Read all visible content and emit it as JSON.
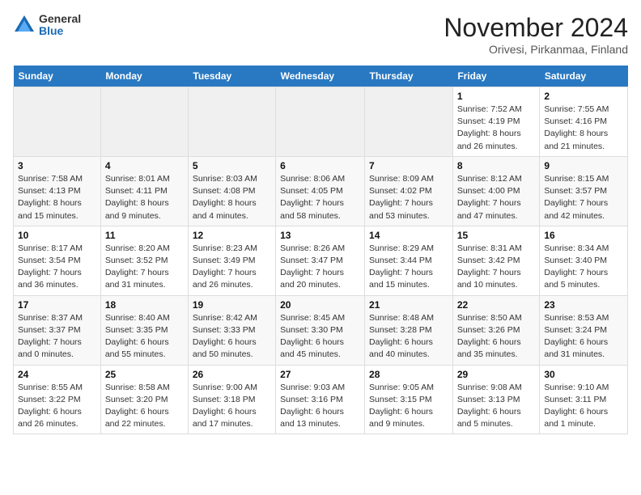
{
  "logo": {
    "general": "General",
    "blue": "Blue"
  },
  "title": "November 2024",
  "subtitle": "Orivesi, Pirkanmaa, Finland",
  "days_of_week": [
    "Sunday",
    "Monday",
    "Tuesday",
    "Wednesday",
    "Thursday",
    "Friday",
    "Saturday"
  ],
  "weeks": [
    [
      {
        "day": "",
        "info": ""
      },
      {
        "day": "",
        "info": ""
      },
      {
        "day": "",
        "info": ""
      },
      {
        "day": "",
        "info": ""
      },
      {
        "day": "",
        "info": ""
      },
      {
        "day": "1",
        "info": "Sunrise: 7:52 AM\nSunset: 4:19 PM\nDaylight: 8 hours and 26 minutes."
      },
      {
        "day": "2",
        "info": "Sunrise: 7:55 AM\nSunset: 4:16 PM\nDaylight: 8 hours and 21 minutes."
      }
    ],
    [
      {
        "day": "3",
        "info": "Sunrise: 7:58 AM\nSunset: 4:13 PM\nDaylight: 8 hours and 15 minutes."
      },
      {
        "day": "4",
        "info": "Sunrise: 8:01 AM\nSunset: 4:11 PM\nDaylight: 8 hours and 9 minutes."
      },
      {
        "day": "5",
        "info": "Sunrise: 8:03 AM\nSunset: 4:08 PM\nDaylight: 8 hours and 4 minutes."
      },
      {
        "day": "6",
        "info": "Sunrise: 8:06 AM\nSunset: 4:05 PM\nDaylight: 7 hours and 58 minutes."
      },
      {
        "day": "7",
        "info": "Sunrise: 8:09 AM\nSunset: 4:02 PM\nDaylight: 7 hours and 53 minutes."
      },
      {
        "day": "8",
        "info": "Sunrise: 8:12 AM\nSunset: 4:00 PM\nDaylight: 7 hours and 47 minutes."
      },
      {
        "day": "9",
        "info": "Sunrise: 8:15 AM\nSunset: 3:57 PM\nDaylight: 7 hours and 42 minutes."
      }
    ],
    [
      {
        "day": "10",
        "info": "Sunrise: 8:17 AM\nSunset: 3:54 PM\nDaylight: 7 hours and 36 minutes."
      },
      {
        "day": "11",
        "info": "Sunrise: 8:20 AM\nSunset: 3:52 PM\nDaylight: 7 hours and 31 minutes."
      },
      {
        "day": "12",
        "info": "Sunrise: 8:23 AM\nSunset: 3:49 PM\nDaylight: 7 hours and 26 minutes."
      },
      {
        "day": "13",
        "info": "Sunrise: 8:26 AM\nSunset: 3:47 PM\nDaylight: 7 hours and 20 minutes."
      },
      {
        "day": "14",
        "info": "Sunrise: 8:29 AM\nSunset: 3:44 PM\nDaylight: 7 hours and 15 minutes."
      },
      {
        "day": "15",
        "info": "Sunrise: 8:31 AM\nSunset: 3:42 PM\nDaylight: 7 hours and 10 minutes."
      },
      {
        "day": "16",
        "info": "Sunrise: 8:34 AM\nSunset: 3:40 PM\nDaylight: 7 hours and 5 minutes."
      }
    ],
    [
      {
        "day": "17",
        "info": "Sunrise: 8:37 AM\nSunset: 3:37 PM\nDaylight: 7 hours and 0 minutes."
      },
      {
        "day": "18",
        "info": "Sunrise: 8:40 AM\nSunset: 3:35 PM\nDaylight: 6 hours and 55 minutes."
      },
      {
        "day": "19",
        "info": "Sunrise: 8:42 AM\nSunset: 3:33 PM\nDaylight: 6 hours and 50 minutes."
      },
      {
        "day": "20",
        "info": "Sunrise: 8:45 AM\nSunset: 3:30 PM\nDaylight: 6 hours and 45 minutes."
      },
      {
        "day": "21",
        "info": "Sunrise: 8:48 AM\nSunset: 3:28 PM\nDaylight: 6 hours and 40 minutes."
      },
      {
        "day": "22",
        "info": "Sunrise: 8:50 AM\nSunset: 3:26 PM\nDaylight: 6 hours and 35 minutes."
      },
      {
        "day": "23",
        "info": "Sunrise: 8:53 AM\nSunset: 3:24 PM\nDaylight: 6 hours and 31 minutes."
      }
    ],
    [
      {
        "day": "24",
        "info": "Sunrise: 8:55 AM\nSunset: 3:22 PM\nDaylight: 6 hours and 26 minutes."
      },
      {
        "day": "25",
        "info": "Sunrise: 8:58 AM\nSunset: 3:20 PM\nDaylight: 6 hours and 22 minutes."
      },
      {
        "day": "26",
        "info": "Sunrise: 9:00 AM\nSunset: 3:18 PM\nDaylight: 6 hours and 17 minutes."
      },
      {
        "day": "27",
        "info": "Sunrise: 9:03 AM\nSunset: 3:16 PM\nDaylight: 6 hours and 13 minutes."
      },
      {
        "day": "28",
        "info": "Sunrise: 9:05 AM\nSunset: 3:15 PM\nDaylight: 6 hours and 9 minutes."
      },
      {
        "day": "29",
        "info": "Sunrise: 9:08 AM\nSunset: 3:13 PM\nDaylight: 6 hours and 5 minutes."
      },
      {
        "day": "30",
        "info": "Sunrise: 9:10 AM\nSunset: 3:11 PM\nDaylight: 6 hours and 1 minute."
      }
    ]
  ]
}
